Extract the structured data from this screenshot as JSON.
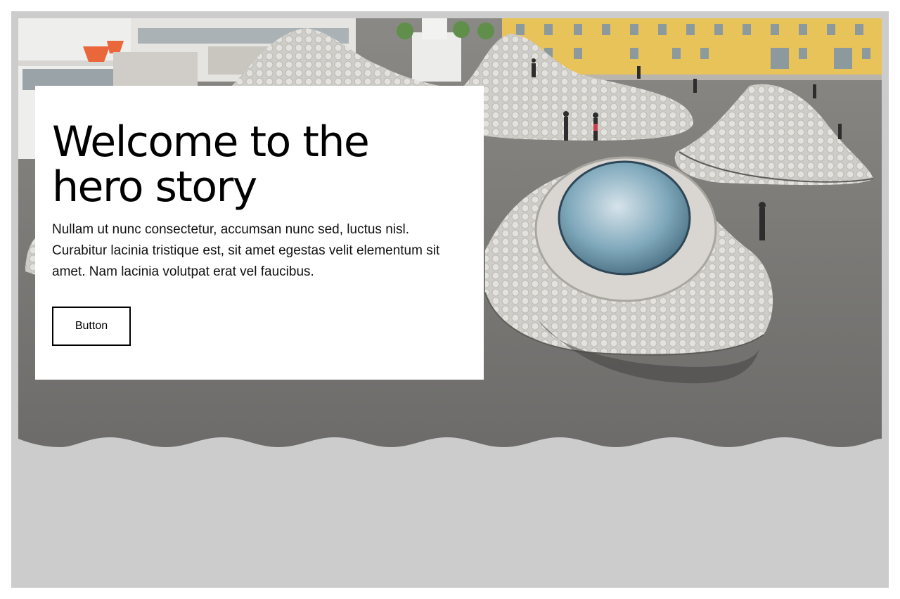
{
  "hero": {
    "title": "Welcome to the hero story",
    "body": "Nullam ut nunc consectetur, accumsan nunc sed, luctus nisl. Curabitur lacinia tristique est, sit amet egestas velit elementum sit amet. Nam lacinia volutpat erat vel faucibus.",
    "button_label": "Button",
    "image_subject": "aerial view of a plaza with tiled domes and a large round skylight",
    "colors": {
      "frame_background": "#cccccc",
      "card_background": "#ffffff",
      "text": "#000000",
      "pavement": "#7a7977",
      "building_yellow": "#e8c35a",
      "skylight_blue": "#6e9fb5"
    }
  }
}
